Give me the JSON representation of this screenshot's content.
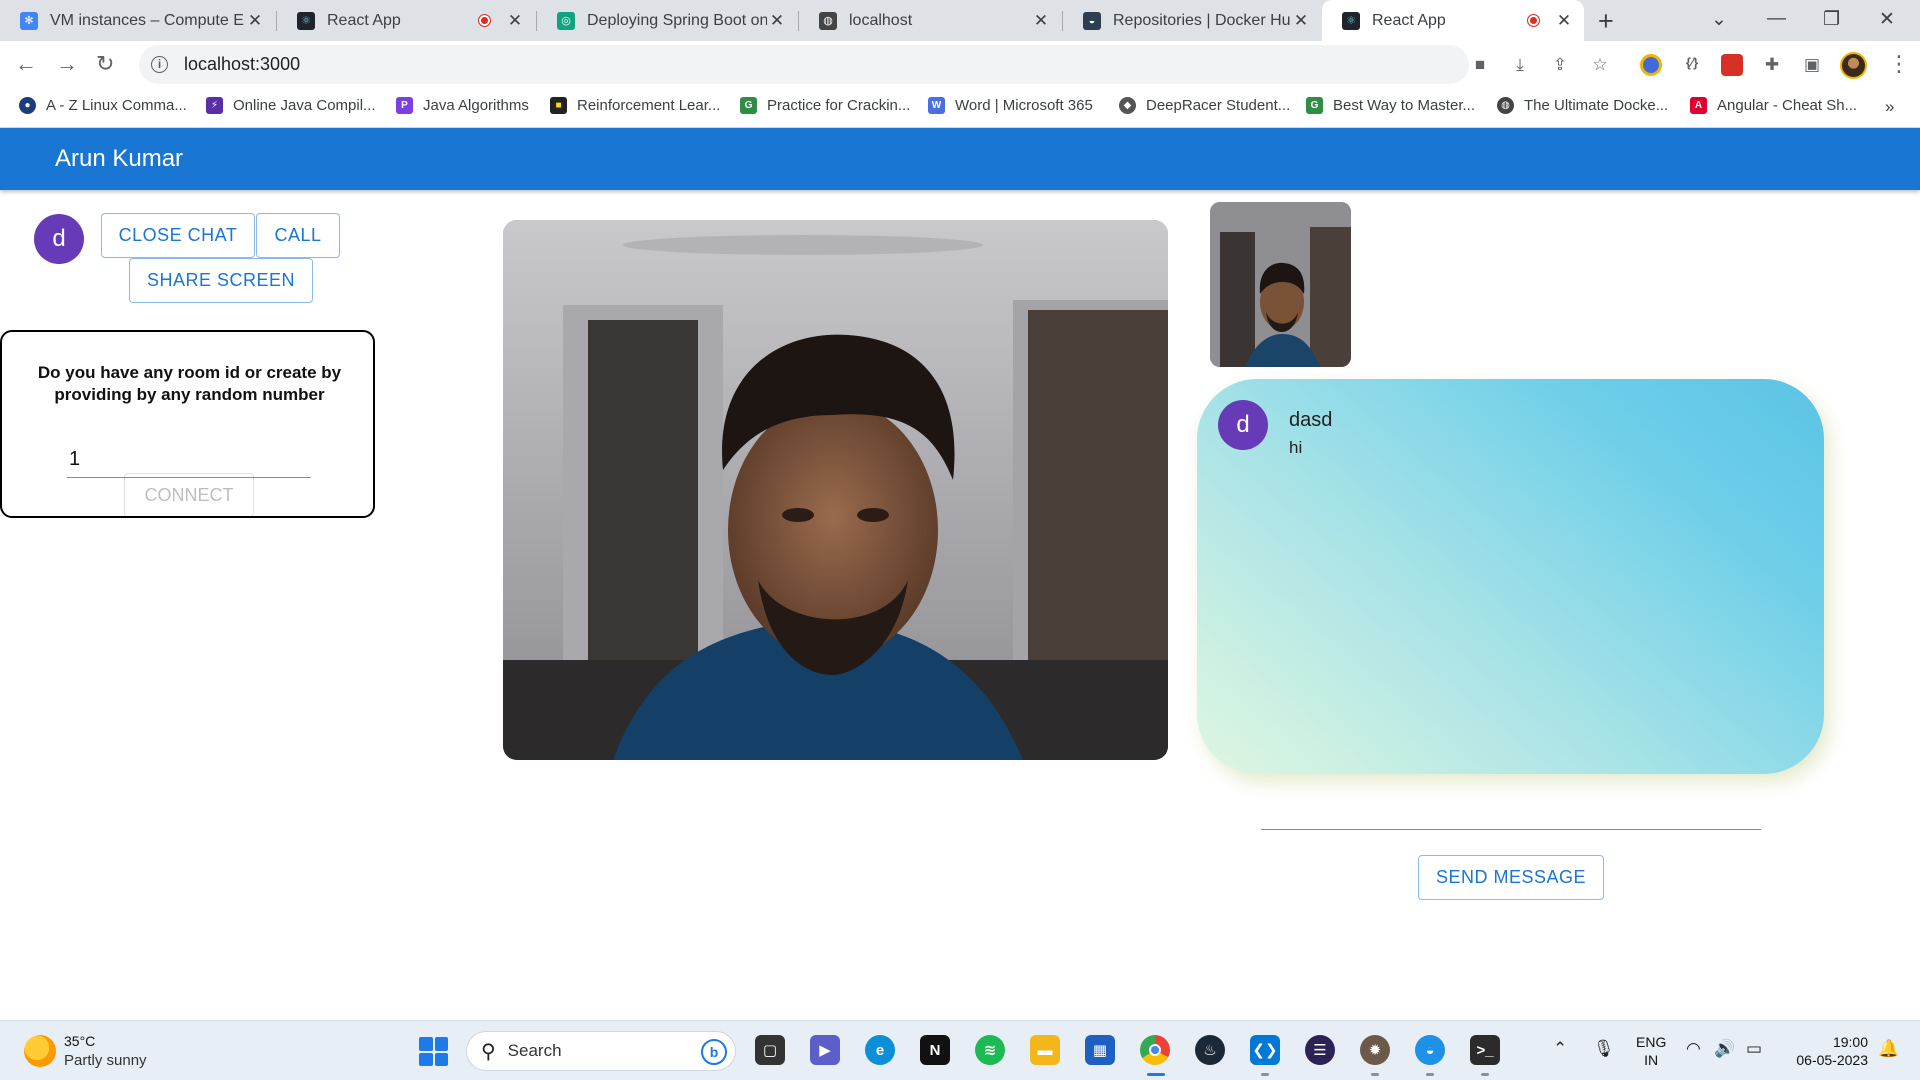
{
  "browser": {
    "tabs": [
      {
        "title": "VM instances – Compute Engine",
        "icon_color": "#4285f4",
        "recording": false,
        "active": false
      },
      {
        "title": "React App",
        "icon_color": "#20232a",
        "recording": true,
        "active": false
      },
      {
        "title": "Deploying Spring Boot on GCP",
        "icon_color": "#10a37f",
        "recording": false,
        "active": false
      },
      {
        "title": "localhost",
        "icon_color": "#444444",
        "recording": false,
        "active": false
      },
      {
        "title": "Repositories | Docker Hub",
        "icon_color": "#2c3e50",
        "recording": false,
        "active": false
      },
      {
        "title": "React App",
        "icon_color": "#20232a",
        "recording": true,
        "active": true
      }
    ],
    "address": "localhost:3000",
    "bookmarks": [
      {
        "label": "A - Z Linux Comma...",
        "color": "#1a3d7c"
      },
      {
        "label": "Online Java Compil...",
        "color": "#5b2ea8"
      },
      {
        "label": "Java Algorithms",
        "color": "#7b3fe4"
      },
      {
        "label": "Reinforcement Lear...",
        "color": "#222222"
      },
      {
        "label": "Practice for Crackin...",
        "color": "#2f8d46"
      },
      {
        "label": "Word | Microsoft 365",
        "color": "#4b6ee0"
      },
      {
        "label": "DeepRacer Student...",
        "color": "#555555"
      },
      {
        "label": "Best Way to Master...",
        "color": "#2f8d46"
      },
      {
        "label": "The Ultimate Docke...",
        "color": "#444444"
      },
      {
        "label": "Angular - Cheat Sh...",
        "color": "#dd0031"
      }
    ]
  },
  "app": {
    "title": "Arun Kumar",
    "avatar_letter": "d",
    "buttons": {
      "close_chat": "CLOSE CHAT",
      "call": "CALL",
      "share_screen": "SHARE SCREEN"
    },
    "room": {
      "question": "Do you have any room id or create by providing by any random number",
      "room_id_value": "1",
      "connect_label": "CONNECT"
    },
    "chat": {
      "messages": [
        {
          "avatar": "d",
          "sender": "dasd",
          "text": "hi"
        }
      ],
      "input_value": "",
      "send_label": "SEND MESSAGE"
    },
    "colors": {
      "primary": "#1976d2",
      "avatar": "#673ab7"
    }
  },
  "taskbar": {
    "weather_temp": "35°C",
    "weather_desc": "Partly sunny",
    "search_label": "Search",
    "language": "ENG",
    "region": "IN",
    "time": "19:00",
    "date": "06-05-2023"
  }
}
